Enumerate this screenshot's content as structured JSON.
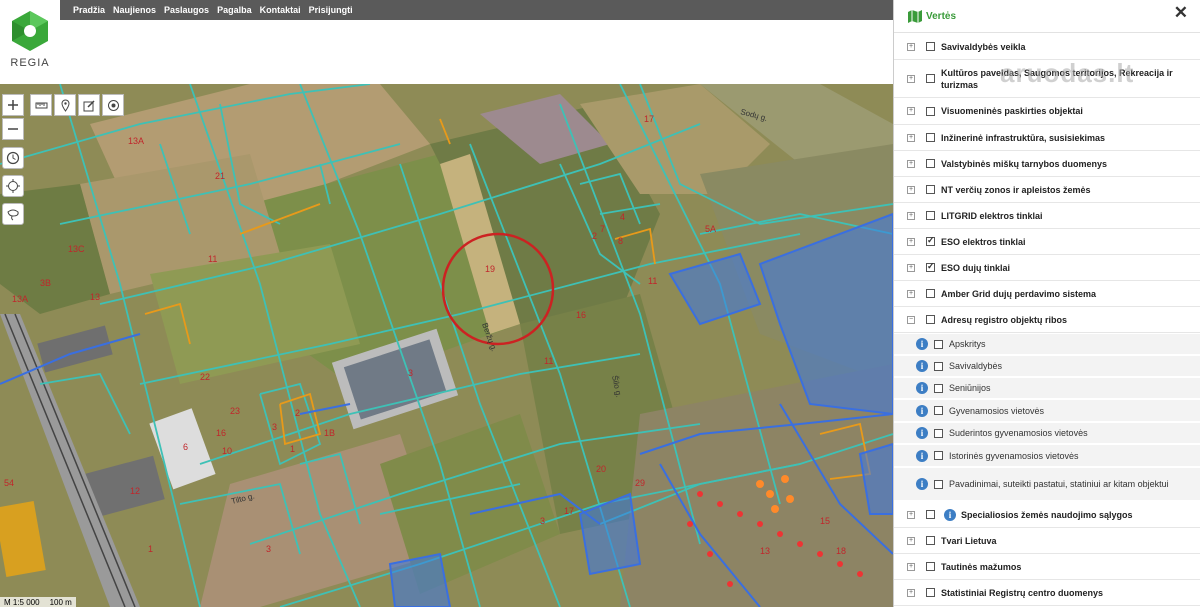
{
  "nav": {
    "items": [
      "Pradžia",
      "Naujienos",
      "Paslaugos",
      "Pagalba",
      "Kontaktai",
      "Prisijungti"
    ]
  },
  "logo": {
    "text": "REGIA",
    "color": "#3aa83a"
  },
  "map": {
    "parcel_labels": [
      "13A",
      "21",
      "13C",
      "11",
      "3B",
      "13",
      "13A",
      "22",
      "23",
      "3",
      "1B",
      "2",
      "1",
      "16",
      "10",
      "6",
      "12",
      "54",
      "1",
      "3",
      "19",
      "16",
      "11",
      "20",
      "3",
      "17",
      "8",
      "7",
      "2",
      "4",
      "11",
      "5A",
      "15",
      "13",
      "18",
      "17",
      "3",
      "29"
    ],
    "street_labels": [
      "Beržų g.",
      "Šilo g.",
      "Sodų g.",
      "Tilto g."
    ],
    "scale_text": "M 1:5 000",
    "scale_bar": "100 m",
    "highlight_circle_color": "#cc2222"
  },
  "sidebar": {
    "title": "Vertės",
    "close_icon": "close-icon",
    "layers": [
      {
        "label": "Savivaldybės veikla",
        "checked": false
      },
      {
        "label": "Kultūros paveldas, Saugomos teritorijos, Rekreacija ir turizmas",
        "checked": false
      },
      {
        "label": "Visuomeninės paskirties objektai",
        "checked": false
      },
      {
        "label": "Inžinerinė infrastruktūra, susisiekimas",
        "checked": false
      },
      {
        "label": "Valstybinės miškų tarnybos duomenys",
        "checked": false
      },
      {
        "label": "NT verčių zonos ir apleistos žemės",
        "checked": false
      },
      {
        "label": "LITGRID elektros tinklai",
        "checked": false
      },
      {
        "label": "ESO elektros tinklai",
        "checked": true
      },
      {
        "label": "ESO dujų tinklai",
        "checked": true
      },
      {
        "label": "Amber Grid dujų perdavimo sistema",
        "checked": false
      },
      {
        "label": "Adresų registro objektų ribos",
        "checked": false
      }
    ],
    "sublayers": [
      "Apskritys",
      "Savivaldybės",
      "Seniūnijos",
      "Gyvenamosios vietovės",
      "Suderintos gyvenamosios vietovės",
      "Istorinės gyvenamosios vietovės",
      "Pavadinimai, suteikti pastatui, statiniui ar kitam objektui"
    ],
    "layers_after": [
      {
        "label": "Specialiosios žemės naudojimo sąlygos",
        "checked": false
      },
      {
        "label": "Tvari Lietuva",
        "checked": false
      },
      {
        "label": "Tautinės mažumos",
        "checked": false
      },
      {
        "label": "Statistiniai Registrų centro duomenys",
        "checked": false
      }
    ]
  },
  "watermark": "aruodas.lt"
}
